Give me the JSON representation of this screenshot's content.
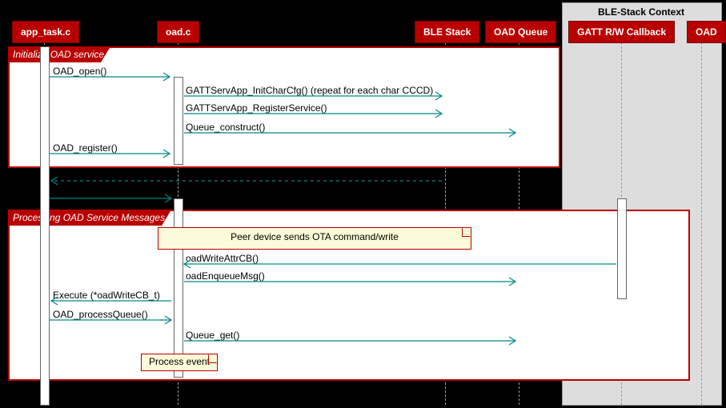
{
  "context_box": {
    "title": "BLE-Stack Context"
  },
  "participants": {
    "app": "app_task.c",
    "oadc": "oad.c",
    "ble": "BLE Stack",
    "queue": "OAD Queue",
    "gatt": "GATT R/W Callback",
    "oad": "OAD"
  },
  "fragments": {
    "init": "Initialize OAD service",
    "proc": "Processing OAD Service Messages"
  },
  "notes": {
    "peer": "Peer device sends OTA command/write",
    "process_event": "Process event"
  },
  "messages": {
    "oad_open": "OAD_open()",
    "init_char": "GATTServApp_InitCharCfg() (repeat for each char CCCD)",
    "reg_service": "GATTServApp_RegisterService()",
    "queue_construct": "Queue_construct()",
    "oad_register": "OAD_register()",
    "oad_write_cb": "oadWriteAttrCB()",
    "oad_enqueue": "oadEnqueueMsg()",
    "execute": "Execute (*oadWriteCB_t)",
    "process_queue": "OAD_processQueue()",
    "queue_get": "Queue_get()"
  },
  "chart_data": {
    "type": "sequence",
    "participants": [
      "app_task.c",
      "oad.c",
      "BLE Stack",
      "OAD Queue",
      "GATT R/W Callback",
      "OAD"
    ],
    "context_group": {
      "name": "BLE-Stack Context",
      "members": [
        "GATT R/W Callback",
        "OAD"
      ]
    },
    "fragments": [
      {
        "label": "Initialize OAD service",
        "events": [
          {
            "from": "app_task.c",
            "to": "oad.c",
            "text": "OAD_open()"
          },
          {
            "from": "oad.c",
            "to": "BLE Stack",
            "text": "GATTServApp_InitCharCfg() (repeat for each char CCCD)"
          },
          {
            "from": "oad.c",
            "to": "BLE Stack",
            "text": "GATTServApp_RegisterService()"
          },
          {
            "from": "oad.c",
            "to": "OAD Queue",
            "text": "Queue_construct()"
          },
          {
            "from": "app_task.c",
            "to": "oad.c",
            "text": "OAD_register()"
          }
        ]
      },
      {
        "return": true,
        "from": "BLE Stack",
        "to": "app_task.c"
      },
      {
        "from": "app_task.c",
        "to": "oad.c",
        "text": ""
      },
      {
        "label": "Processing OAD Service Messages",
        "events": [
          {
            "note": "Peer device sends OTA command/write"
          },
          {
            "from": "GATT R/W Callback",
            "to": "oad.c",
            "text": "oadWriteAttrCB()"
          },
          {
            "from": "oad.c",
            "to": "OAD Queue",
            "text": "oadEnqueueMsg()"
          },
          {
            "from": "oad.c",
            "to": "app_task.c",
            "text": "Execute (*oadWriteCB_t)"
          },
          {
            "from": "app_task.c",
            "to": "oad.c",
            "text": "OAD_processQueue()"
          },
          {
            "from": "oad.c",
            "to": "OAD Queue",
            "text": "Queue_get()"
          },
          {
            "note": "Process event"
          }
        ]
      }
    ]
  }
}
